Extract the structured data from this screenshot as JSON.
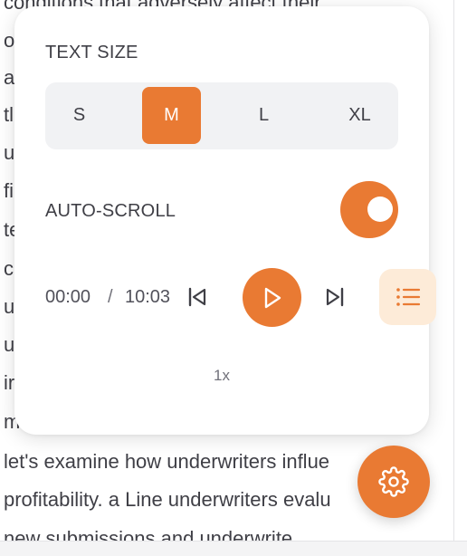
{
  "article": {
    "lines": [
      "conditions that adversely affect their",
      "o",
      "a",
      "tl",
      "u",
      "fi",
      "te",
      "c",
      "u",
      "u",
      "ir",
      "m",
      "let's examine how underwriters influe",
      "profitability. a Line underwriters evalu",
      "new submissions and underwrite"
    ]
  },
  "settings": {
    "text_size": {
      "label": "TEXT SIZE",
      "options": [
        "S",
        "M",
        "L",
        "XL"
      ],
      "selected": "M"
    },
    "auto_scroll": {
      "label": "AUTO-SCROLL",
      "enabled": true
    }
  },
  "player": {
    "current_time": "00:00",
    "separator": "/",
    "duration": "10:03",
    "speed": "1x"
  },
  "colors": {
    "accent": "#e97a33",
    "accent_soft": "#fdebd8",
    "segment_bg": "#f1f2f4",
    "text": "#3f3f46"
  },
  "icons": {
    "previous": "skip-previous-icon",
    "play": "play-icon",
    "next": "skip-next-icon",
    "list": "list-icon",
    "settings": "gear-icon"
  }
}
